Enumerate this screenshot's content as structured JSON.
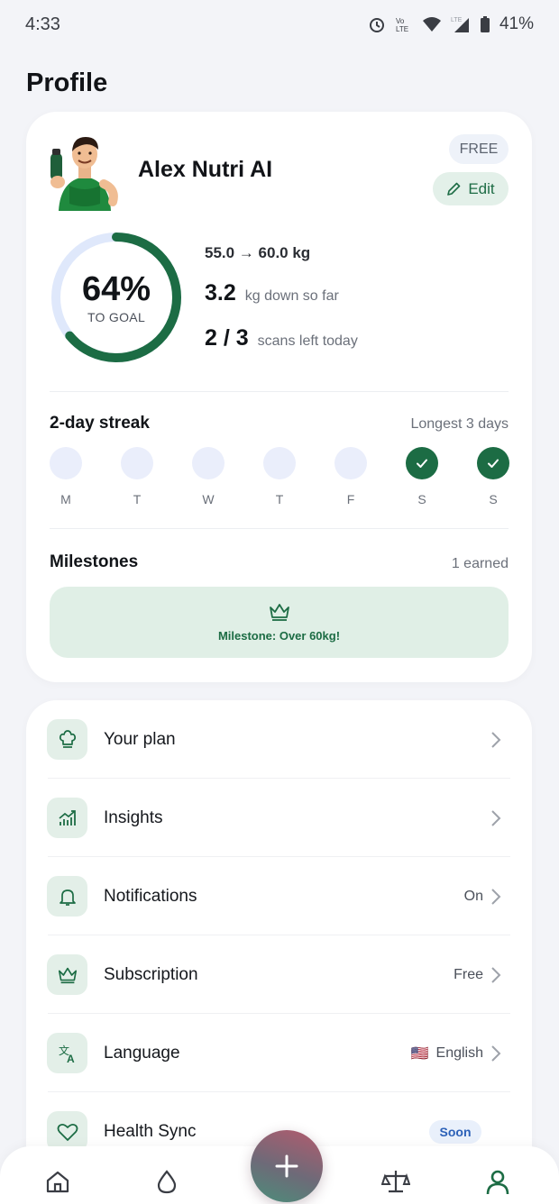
{
  "status_bar": {
    "time": "4:33",
    "battery": "41%"
  },
  "page": {
    "title": "Profile"
  },
  "profile": {
    "name": "Alex Nutri AI",
    "plan_badge": "FREE",
    "edit_label": "Edit",
    "goal_percent_text": "64%",
    "goal_progress": 0.64,
    "goal_label": "TO GOAL",
    "weight_range": "55.0 → 60.0 kg",
    "down_value": "3.2",
    "down_label": "kg down so far",
    "scans_value": "2 / 3",
    "scans_label": "scans left today"
  },
  "streak": {
    "title": "2-day streak",
    "longest": "Longest 3 days",
    "days": [
      {
        "label": "M",
        "done": false
      },
      {
        "label": "T",
        "done": false
      },
      {
        "label": "W",
        "done": false
      },
      {
        "label": "T",
        "done": false
      },
      {
        "label": "F",
        "done": false
      },
      {
        "label": "S",
        "done": true
      },
      {
        "label": "S",
        "done": true
      }
    ]
  },
  "milestones": {
    "title": "Milestones",
    "earned": "1 earned",
    "item": "Milestone: Over 60kg!"
  },
  "menu": {
    "items": [
      {
        "label": "Your plan",
        "value": "",
        "icon": "chef-hat-icon"
      },
      {
        "label": "Insights",
        "value": "",
        "icon": "chart-icon"
      },
      {
        "label": "Notifications",
        "value": "On",
        "icon": "bell-icon"
      },
      {
        "label": "Subscription",
        "value": "Free",
        "icon": "crown-icon"
      },
      {
        "label": "Language",
        "value": "English",
        "flag": "🇺🇸",
        "icon": "translate-icon"
      },
      {
        "label": "Health Sync",
        "badge": "Soon",
        "icon": "heart-icon"
      }
    ]
  },
  "nav": {
    "items": [
      "home-icon",
      "water-drop-icon",
      "add-icon",
      "scale-icon",
      "profile-icon"
    ]
  },
  "colors": {
    "accent": "#1c6c44",
    "accent_light": "#e0efe6",
    "background": "#f3f4f8"
  }
}
